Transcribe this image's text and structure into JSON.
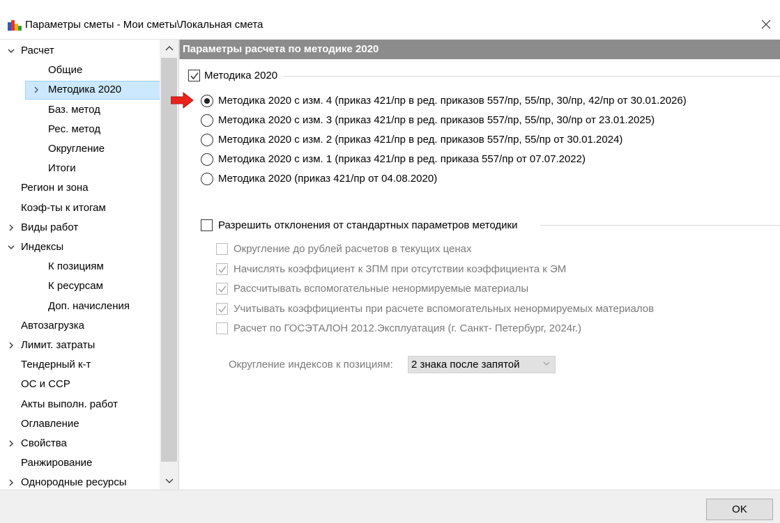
{
  "window": {
    "title": "Параметры сметы - Мои сметы\\Локальная смета"
  },
  "tree": {
    "items": [
      {
        "label": "Расчет",
        "level": 0,
        "expander": "expanded"
      },
      {
        "label": "Общие",
        "level": 1,
        "expander": "none"
      },
      {
        "label": "Методика 2020",
        "level": 1,
        "expander": "collapsed",
        "selected": true
      },
      {
        "label": "Баз. метод",
        "level": 1,
        "expander": "none"
      },
      {
        "label": "Рес. метод",
        "level": 1,
        "expander": "none"
      },
      {
        "label": "Округление",
        "level": 1,
        "expander": "none"
      },
      {
        "label": "Итоги",
        "level": 1,
        "expander": "none"
      },
      {
        "label": "Регион и зона",
        "level": 0,
        "expander": "none"
      },
      {
        "label": "Коэф-ты к итогам",
        "level": 0,
        "expander": "none"
      },
      {
        "label": "Виды работ",
        "level": 0,
        "expander": "collapsed"
      },
      {
        "label": "Индексы",
        "level": 0,
        "expander": "expanded"
      },
      {
        "label": "К позициям",
        "level": 1,
        "expander": "none"
      },
      {
        "label": "К ресурсам",
        "level": 1,
        "expander": "none"
      },
      {
        "label": "Доп. начисления",
        "level": 1,
        "expander": "none"
      },
      {
        "label": "Автозагрузка",
        "level": 0,
        "expander": "none"
      },
      {
        "label": "Лимит. затраты",
        "level": 0,
        "expander": "collapsed"
      },
      {
        "label": "Тендерный к-т",
        "level": 0,
        "expander": "none"
      },
      {
        "label": "ОС и ССР",
        "level": 0,
        "expander": "none"
      },
      {
        "label": "Акты выполн. работ",
        "level": 0,
        "expander": "none"
      },
      {
        "label": "Оглавление",
        "level": 0,
        "expander": "none"
      },
      {
        "label": "Свойства",
        "level": 0,
        "expander": "collapsed"
      },
      {
        "label": "Ранжирование",
        "level": 0,
        "expander": "none"
      },
      {
        "label": "Однородные ресурсы",
        "level": 0,
        "expander": "collapsed"
      }
    ]
  },
  "panel": {
    "header": "Параметры расчета по методике 2020",
    "methodology_group": {
      "label": "Методика 2020",
      "checked": true,
      "options": [
        {
          "label": "Методика 2020 с изм. 4 (приказ 421/пр в ред. приказов 557/пр, 55/пр, 30/пр, 42/пр от 30.01.2026)",
          "selected": true
        },
        {
          "label": "Методика 2020 с изм. 3 (приказ 421/пр в ред. приказов 557/пр, 55/пр, 30/пр от 23.01.2025)",
          "selected": false
        },
        {
          "label": "Методика 2020 с изм. 2 (приказ 421/пр в ред. приказов 557/пр, 55/пр от 30.01.2024)",
          "selected": false
        },
        {
          "label": "Методика 2020 с изм. 1 (приказ 421/пр в ред. приказа 557/пр от 07.07.2022)",
          "selected": false
        },
        {
          "label": "Методика 2020 (приказ 421/пр от 04.08.2020)",
          "selected": false
        }
      ]
    },
    "deviation_group": {
      "label": "Разрешить отклонения от стандартных параметров методики",
      "checked": false,
      "options": [
        {
          "label": "Округление до рублей расчетов в текущих ценах",
          "checked": false
        },
        {
          "label": "Начислять коэффициент к ЗПМ при отсутствии коэффициента к ЭМ",
          "checked": true
        },
        {
          "label": "Рассчитывать вспомогательные ненормируемые материалы",
          "checked": true
        },
        {
          "label": "Учитывать коэффициенты при расчете вспомогательных ненормируемых материалов",
          "checked": true
        },
        {
          "label": "Расчет по ГОСЭТАЛОН 2012.Эксплуатация (г. Санкт- Петербург, 2024г.)",
          "checked": false
        }
      ],
      "rounding_label": "Округление индексов к позициям:",
      "rounding_value": "2 знака после запятой"
    }
  },
  "footer": {
    "ok_label": "OK"
  },
  "colors": {
    "header_bg": "#8c8c8c",
    "selection_bg": "#cce8ff",
    "arrow": "#e8231c"
  }
}
